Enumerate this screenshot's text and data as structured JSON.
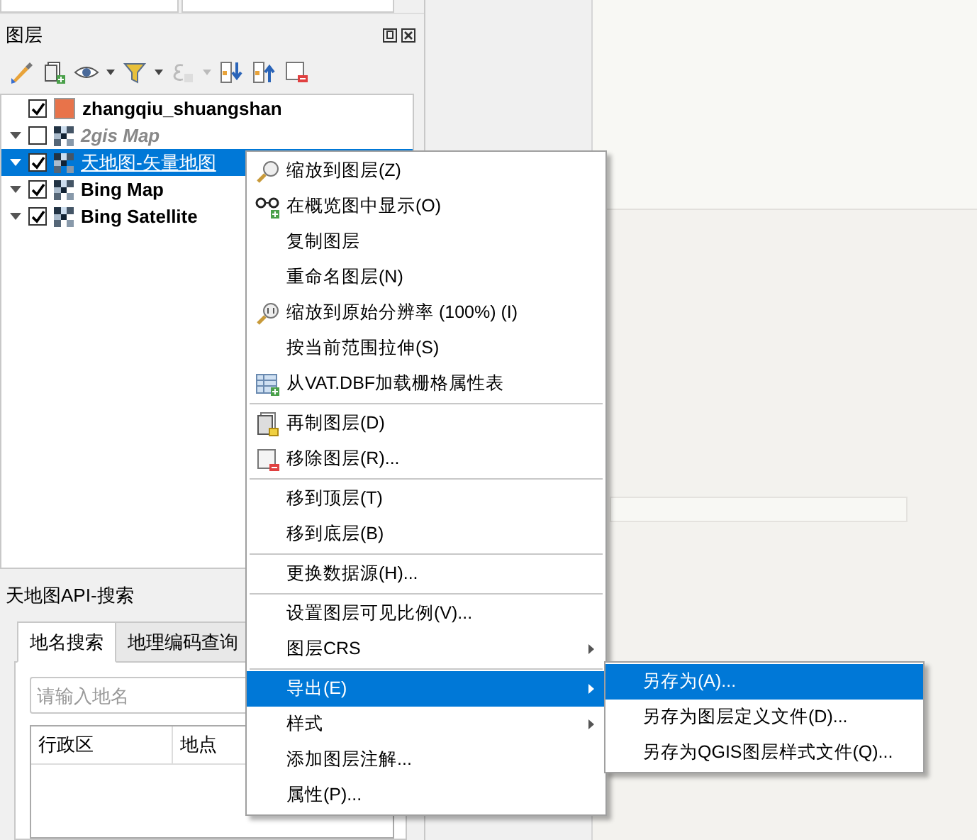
{
  "layers_panel": {
    "title": "图层"
  },
  "layers": [
    {
      "name": "zhangqiu_shuangshan",
      "kind": "vector",
      "color": "#e8734a",
      "checked": true,
      "selected": false
    },
    {
      "name": "2gis Map",
      "kind": "raster",
      "checked": false,
      "selected": false
    },
    {
      "name": "天地图-矢量地图",
      "kind": "raster",
      "checked": true,
      "selected": true
    },
    {
      "name": "Bing Map",
      "kind": "raster",
      "checked": true,
      "selected": false
    },
    {
      "name": "Bing Satellite",
      "kind": "raster",
      "checked": true,
      "selected": false
    }
  ],
  "search_panel": {
    "title": "天地图API-搜索",
    "tabs": [
      {
        "label": "地名搜索",
        "selected": true
      },
      {
        "label": "地理编码查询",
        "selected": false
      }
    ],
    "search": {
      "placeholder": "请输入地名"
    },
    "table": {
      "columns": [
        "行政区",
        "地点"
      ]
    }
  },
  "context_menu": [
    {
      "kind": "item",
      "label": "缩放到图层(Z)",
      "selected": false,
      "submenu": false
    },
    {
      "kind": "item",
      "label": "在概览图中显示(O)",
      "selected": false,
      "submenu": false
    },
    {
      "kind": "item",
      "label": "复制图层",
      "selected": false,
      "submenu": false
    },
    {
      "kind": "item",
      "label": "重命名图层(N)",
      "selected": false,
      "submenu": false
    },
    {
      "kind": "item",
      "label": "缩放到原始分辨率 (100%) (I)",
      "selected": false,
      "submenu": false
    },
    {
      "kind": "item",
      "label": "按当前范围拉伸(S)",
      "selected": false,
      "submenu": false
    },
    {
      "kind": "item",
      "label": "从VAT.DBF加载栅格属性表",
      "selected": false,
      "submenu": false
    },
    {
      "kind": "separator"
    },
    {
      "kind": "item",
      "label": "再制图层(D)",
      "selected": false,
      "submenu": false
    },
    {
      "kind": "item",
      "label": "移除图层(R)...",
      "selected": false,
      "submenu": false
    },
    {
      "kind": "separator"
    },
    {
      "kind": "item",
      "label": "移到顶层(T)",
      "selected": false,
      "submenu": false
    },
    {
      "kind": "item",
      "label": "移到底层(B)",
      "selected": false,
      "submenu": false
    },
    {
      "kind": "separator"
    },
    {
      "kind": "item",
      "label": "更换数据源(H)...",
      "selected": false,
      "submenu": false
    },
    {
      "kind": "separator"
    },
    {
      "kind": "item",
      "label": "设置图层可见比例(V)...",
      "selected": false,
      "submenu": false
    },
    {
      "kind": "item",
      "label": "图层CRS",
      "selected": false,
      "submenu": true
    },
    {
      "kind": "separator"
    },
    {
      "kind": "item",
      "label": "导出(E)",
      "selected": true,
      "submenu": true
    },
    {
      "kind": "item",
      "label": "样式",
      "selected": false,
      "submenu": true
    },
    {
      "kind": "item",
      "label": "添加图层注解...",
      "selected": false,
      "submenu": false
    },
    {
      "kind": "item",
      "label": "属性(P)...",
      "selected": false,
      "submenu": false
    }
  ],
  "submenu": [
    {
      "label": "另存为(A)...",
      "selected": true
    },
    {
      "label": "另存为图层定义文件(D)...",
      "selected": false
    },
    {
      "label": "另存为QGIS图层样式文件(Q)...",
      "selected": false
    }
  ]
}
